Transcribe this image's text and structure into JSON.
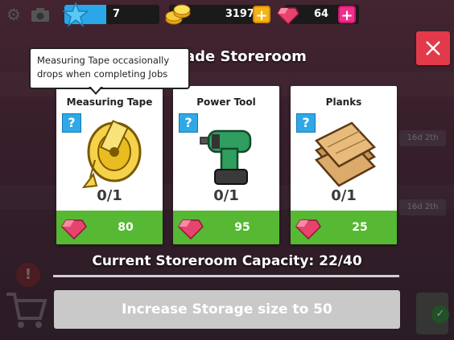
{
  "topbar": {
    "xp_value": "7",
    "xp_progress": 0.44,
    "coins": "3197",
    "gems": "64",
    "icons": [
      "gear-icon",
      "camera-icon",
      "star-icon",
      "coins-icon",
      "plus-icon",
      "gem-icon",
      "plus-icon"
    ]
  },
  "dialog": {
    "title": "ade Storeroom",
    "tooltip": "Measuring Tape occasionally drops when completing Jobs",
    "items": [
      {
        "name": "Measuring Tape",
        "badge": "?",
        "count": "0/1",
        "price": "80",
        "icon": "measuring-tape-icon"
      },
      {
        "name": "Power Tool",
        "badge": "?",
        "count": "0/1",
        "price": "95",
        "icon": "power-drill-icon"
      },
      {
        "name": "Planks",
        "badge": "?",
        "count": "0/1",
        "price": "25",
        "icon": "planks-icon"
      }
    ],
    "capacity_text": "Current Storeroom Capacity: 22/40",
    "increase_button": "Increase Storage size to 50"
  },
  "background": {
    "timers": [
      "16d 2th",
      "16d 2th"
    ],
    "warning_badge": "!",
    "check_badge": "✓"
  },
  "colors": {
    "price_green": "#56b833",
    "close_red": "#e23a4b",
    "badge_blue": "#2fa8e6",
    "gem_pink": "#f02f8c",
    "gold": "#f4b41a",
    "xp_blue": "#2aa7e8"
  }
}
